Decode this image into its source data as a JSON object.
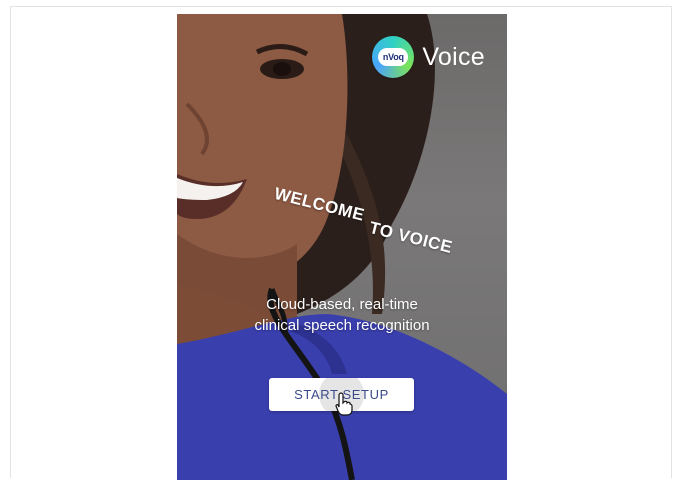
{
  "app": {
    "name": "Voice",
    "logo_text": "nVoq"
  },
  "welcome": {
    "line1": "WELCOME",
    "line2": "TO VOICE"
  },
  "subtitle": {
    "line1": "Cloud-based, real-time",
    "line2": "clinical speech recognition"
  },
  "actions": {
    "start_setup": "START SETUP"
  },
  "colors": {
    "button_text": "#3b4a8a",
    "scrubs": "#3a3fae",
    "logo_navy": "#1e2f7a"
  },
  "icons": {
    "cursor": "hand-pointer-icon"
  }
}
